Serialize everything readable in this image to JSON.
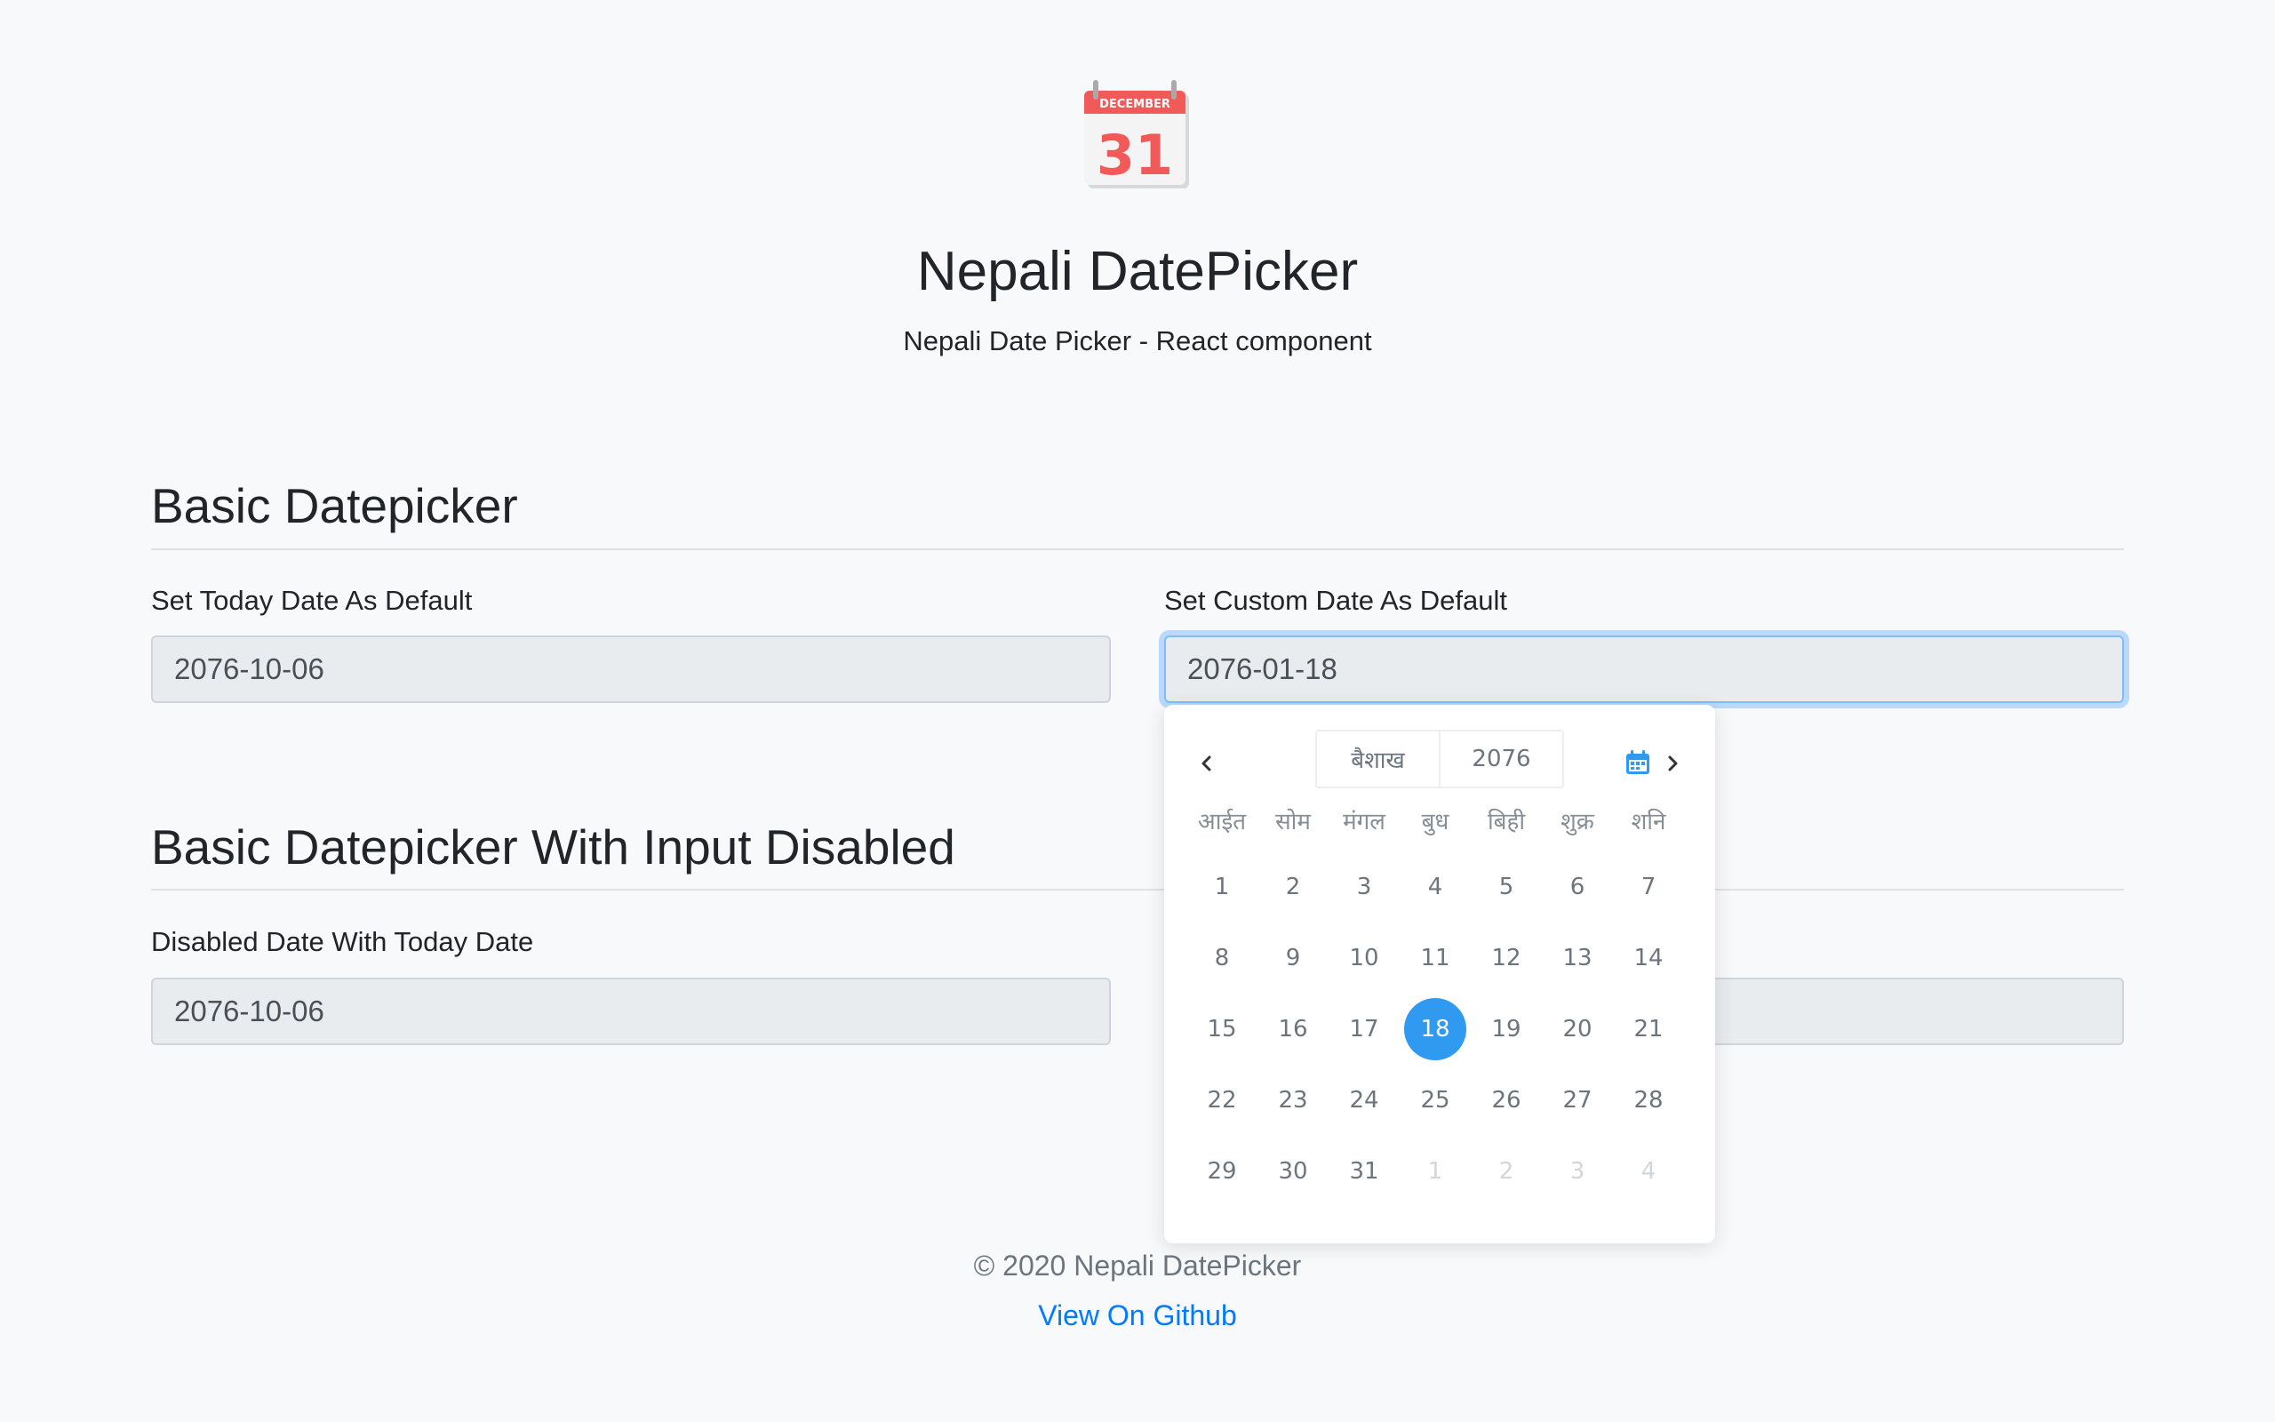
{
  "header": {
    "logo_month": "DECEMBER",
    "logo_day": "31",
    "title": "Nepali DatePicker",
    "subtitle": "Nepali Date Picker - React component"
  },
  "sections": [
    {
      "title": "Basic Datepicker",
      "fields": [
        {
          "label": "Set Today Date As Default",
          "value": "2076-10-06"
        },
        {
          "label": "Set Custom Date As Default",
          "value": "2076-01-18"
        }
      ]
    },
    {
      "title": "Basic Datepicker With Input Disabled",
      "fields": [
        {
          "label": "Disabled Date With Today Date",
          "value": "2076-10-06"
        },
        {
          "label": "",
          "value": ""
        }
      ]
    }
  ],
  "calendar": {
    "month": "बैशाख",
    "year": "2076",
    "weekdays": [
      "आईत",
      "सोम",
      "मंगल",
      "बुध",
      "बिही",
      "शुक्र",
      "शनि"
    ],
    "weeks": [
      [
        "1",
        "2",
        "3",
        "4",
        "5",
        "6",
        "7"
      ],
      [
        "8",
        "9",
        "10",
        "11",
        "12",
        "13",
        "14"
      ],
      [
        "15",
        "16",
        "17",
        "18",
        "19",
        "20",
        "21"
      ],
      [
        "22",
        "23",
        "24",
        "25",
        "26",
        "27",
        "28"
      ],
      [
        "29",
        "30",
        "31",
        "1",
        "2",
        "3",
        "4"
      ]
    ],
    "selected_day": "18",
    "accent_color": "#2f9af0"
  },
  "footer": {
    "copyright": "© 2020 Nepali DatePicker",
    "link": "View On Github"
  },
  "colors": {
    "background": "#f8f9fa",
    "link": "#007bff",
    "input_bg": "#e9ecef",
    "focus_border": "#80bdff",
    "logo_red": "#f25a5a"
  }
}
